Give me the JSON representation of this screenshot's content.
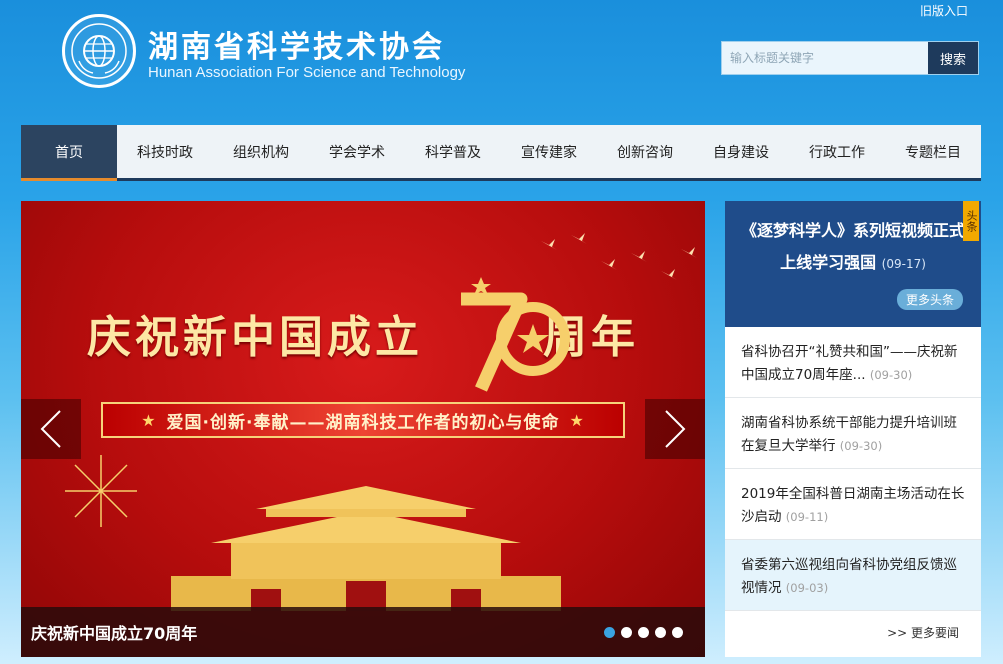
{
  "header": {
    "title_cn": "湖南省科学技术协会",
    "title_en": "Hunan Association For Science and Technology",
    "old_entry": "旧版入口",
    "search_placeholder": "输入标题关键字",
    "search_button": "搜索"
  },
  "nav": {
    "items": [
      {
        "label": "首页"
      },
      {
        "label": "科技时政"
      },
      {
        "label": "组织机构"
      },
      {
        "label": "学会学术"
      },
      {
        "label": "科学普及"
      },
      {
        "label": "宣传建家"
      },
      {
        "label": "创新咨询"
      },
      {
        "label": "自身建设"
      },
      {
        "label": "行政工作"
      },
      {
        "label": "专题栏目"
      }
    ]
  },
  "carousel": {
    "banner_title_left": "庆祝新中国成立",
    "banner_70": "70",
    "banner_title_right": "周年",
    "slogan": "爱国·创新·奉献——湖南科技工作者的初心与使命",
    "caption": "庆祝新中国成立70周年",
    "slide_count": 5,
    "active_slide": 1
  },
  "headline": {
    "tag": "头条",
    "text": "《逐梦科学人》系列短视频正式上线学习强国",
    "date": "(09-17)",
    "more": "更多头条"
  },
  "news": {
    "items": [
      {
        "title": "省科协召开“礼赞共和国”——庆祝新中国成立70周年座...",
        "date": "(09-30)"
      },
      {
        "title": "湖南省科协系统干部能力提升培训班在复旦大学举行",
        "date": "(09-30)"
      },
      {
        "title": "2019年全国科普日湖南主场活动在长沙启动",
        "date": "(09-11)"
      },
      {
        "title": "省委第六巡视组向省科协党组反馈巡视情况",
        "date": "(09-03)"
      }
    ],
    "more": ">> 更多要闻"
  },
  "colors": {
    "nav_active": "#2c4460",
    "nav_accent": "#e68b2c",
    "headline_bg": "#1f4c8a",
    "banner_red": "#c41212"
  }
}
